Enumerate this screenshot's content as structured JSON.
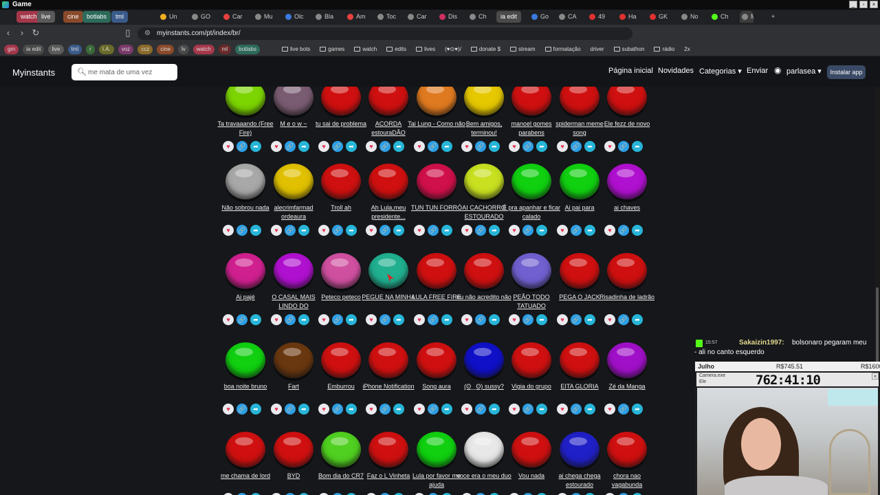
{
  "window": {
    "title": "Game"
  },
  "tabs": [
    {
      "label": "watch",
      "grp": "#a5374a"
    },
    {
      "label": "live",
      "grp": "#5a5a5a"
    },
    {
      "label": "cine",
      "grp": "#8a4a2a"
    },
    {
      "label": "botlabs",
      "grp": "#2d6a5a"
    },
    {
      "label": "tml",
      "grp": "#3a5a8a"
    },
    {
      "label": "Un",
      "ico": "#f0b020"
    },
    {
      "label": "GO",
      "ico": "#888"
    },
    {
      "label": "Car",
      "ico": "#e84040"
    },
    {
      "label": "Mu",
      "ico": "#888"
    },
    {
      "label": "Olc",
      "ico": "#3a7ae0"
    },
    {
      "label": "Bla",
      "ico": "#888"
    },
    {
      "label": "Am",
      "ico": "#e84040"
    },
    {
      "label": "Toc",
      "ico": "#888"
    },
    {
      "label": "Car",
      "ico": "#888"
    },
    {
      "label": "Dis",
      "ico": "#d03060"
    },
    {
      "label": "Ch",
      "ico": "#888"
    },
    {
      "label": "ia edit",
      "grp": "#4a4a4a"
    },
    {
      "label": "Go",
      "ico": "#3a7ae0"
    },
    {
      "label": "CA",
      "ico": "#888"
    },
    {
      "label": "49",
      "ico": "#e03030"
    },
    {
      "label": "Ha",
      "ico": "#e03030"
    },
    {
      "label": "GK",
      "ico": "#e03030"
    },
    {
      "label": "No",
      "ico": "#888"
    },
    {
      "label": "Ch",
      "ico": "#53fc18"
    },
    {
      "label": "M",
      "ico": "#888",
      "active": true
    }
  ],
  "url": "myinstants.com/pt/index/br/",
  "bookmarks": [
    {
      "label": "gm",
      "grp": "#a5374a"
    },
    {
      "label": "ia edit",
      "grp": "#4a4a4a"
    },
    {
      "label": "live",
      "grp": "#5a5a5a"
    },
    {
      "label": "tml",
      "grp": "#3a5a8a"
    },
    {
      "label": "r",
      "grp": "#3a6a3a"
    },
    {
      "label": "I.A.",
      "grp": "#6a6a2a"
    },
    {
      "label": "voz",
      "grp": "#7a3a6a"
    },
    {
      "label": "ccz",
      "grp": "#8a6a2a"
    },
    {
      "label": "cine",
      "grp": "#8a4a2a"
    },
    {
      "label": "lv",
      "grp": "#4a4a4a"
    },
    {
      "label": "watch",
      "grp": "#a5374a"
    },
    {
      "label": "ml",
      "grp": "#6a2a2a"
    },
    {
      "label": "botlabs",
      "grp": "#2d6a5a"
    },
    {
      "label": "live bots",
      "folder": true
    },
    {
      "label": "games",
      "folder": true
    },
    {
      "label": "watch",
      "folder": true
    },
    {
      "label": "edits",
      "folder": true
    },
    {
      "label": "lives",
      "folder": true
    },
    {
      "label": "(♥⊙♥)/",
      "folder": false
    },
    {
      "label": "donate $",
      "folder": true
    },
    {
      "label": "stream",
      "folder": true
    },
    {
      "label": "formatação",
      "folder": true
    },
    {
      "label": "driver",
      "folder": false
    },
    {
      "label": "subathon",
      "folder": true
    },
    {
      "label": "rádio",
      "folder": true
    },
    {
      "label": "2x",
      "folder": false
    }
  ],
  "site": {
    "logo": "Myinstants",
    "search_value": "me mata de uma vez",
    "nav": [
      "Página inicial",
      "Novidades",
      "Categorias ▾",
      "Enviar",
      "parlasea ▾"
    ],
    "install": "Instalar app"
  },
  "rows": [
    [
      {
        "name": "Ta travaaando (Free Fire)",
        "color": "#7cd400"
      },
      {
        "name": "M e o w ~",
        "color": "#7a5c72"
      },
      {
        "name": "tu sai de problema",
        "color": "#d01010"
      },
      {
        "name": "ACORDA estouraDÃO",
        "color": "#d01010"
      },
      {
        "name": "Tai Lung - Como não",
        "color": "#e07a20"
      },
      {
        "name": "Bem amigos, terminou!",
        "color": "#e6c800"
      },
      {
        "name": "manoel gomes parabens",
        "color": "#d01010"
      },
      {
        "name": "spiderman meme song",
        "color": "#d01010"
      },
      {
        "name": "Ele fezz de novo",
        "color": "#d01010"
      }
    ],
    [
      {
        "name": "Não sobrou nada",
        "color": "#a8a8a8"
      },
      {
        "name": "alecrimfarmad ordeaura",
        "color": "#e0c000"
      },
      {
        "name": "Troll ah",
        "color": "#d01010"
      },
      {
        "name": "Ah Lula,meu presidente...",
        "color": "#d01010"
      },
      {
        "name": "TUN TUN FORRÓ",
        "color": "#d0104a"
      },
      {
        "name": "AI CACHORRO ESTOURADO",
        "color": "#c8e020"
      },
      {
        "name": "É pra apanhar e ficar calado",
        "color": "#10d010"
      },
      {
        "name": "Ai pai para",
        "color": "#10d010"
      },
      {
        "name": "ai chaves",
        "color": "#b010d0"
      }
    ],
    [
      {
        "name": "Ai pajé",
        "color": "#d02090"
      },
      {
        "name": "O CASAL MAIS LINDO DO",
        "color": "#b010d0"
      },
      {
        "name": "Peteco peteco",
        "color": "#d050a0"
      },
      {
        "name": "PEGUE NA MINHA",
        "color": "#20b090"
      },
      {
        "name": "LULA FREE FIRE",
        "color": "#d01010"
      },
      {
        "name": "eu não acredito não",
        "color": "#d01010"
      },
      {
        "name": "PEÃO TODO TATUADO",
        "color": "#7060d0"
      },
      {
        "name": "PEGA O JACK",
        "color": "#d01010"
      },
      {
        "name": "Risadinha de ladrão",
        "color": "#d01010"
      }
    ],
    [
      {
        "name": "boa noite bruno",
        "color": "#10d010"
      },
      {
        "name": "Fart",
        "color": "#6a3810"
      },
      {
        "name": "Emburrou",
        "color": "#d01010"
      },
      {
        "name": "iPhone Notification",
        "color": "#d01010"
      },
      {
        "name": "Song aura",
        "color": "#d01010"
      },
      {
        "name": "(ʘ‿ʘ) sussy?",
        "color": "#1010c8"
      },
      {
        "name": "Vigia do grupo",
        "color": "#d01010"
      },
      {
        "name": "EITA GLORIA",
        "color": "#d01010"
      },
      {
        "name": "Zé da Manga",
        "color": "#a010c8"
      }
    ],
    [
      {
        "name": "me chama de lord",
        "color": "#d01010"
      },
      {
        "name": "BYD",
        "color": "#d01010"
      },
      {
        "name": "Bom dia do CR7",
        "color": "#50d020"
      },
      {
        "name": "Faz o L Vinheta",
        "color": "#d01010"
      },
      {
        "name": "Lula por favor me ajuda",
        "color": "#10d010"
      },
      {
        "name": "voce era o meu duo",
        "color": "#e8e8e8"
      },
      {
        "name": "Vou nada",
        "color": "#d01010"
      },
      {
        "name": "ai chega chega estourado",
        "color": "#2020c8"
      },
      {
        "name": "chora nao vagabunda",
        "color": "#d01010"
      }
    ]
  ],
  "icons": {
    "fav": "♥",
    "link": "🔗",
    "share": "➦"
  },
  "chat": {
    "time": "15:57",
    "user": "Sakaizin1997:",
    "msg1": "bolsonaro pegaram meu",
    "msg2": "- ali no canto esquerdo"
  },
  "overlay": {
    "month": "Julho",
    "value1": "R$745.51",
    "value2": "R$1600",
    "app": "Camera.exe",
    "file": "Ele",
    "timer": "762:41:10"
  }
}
